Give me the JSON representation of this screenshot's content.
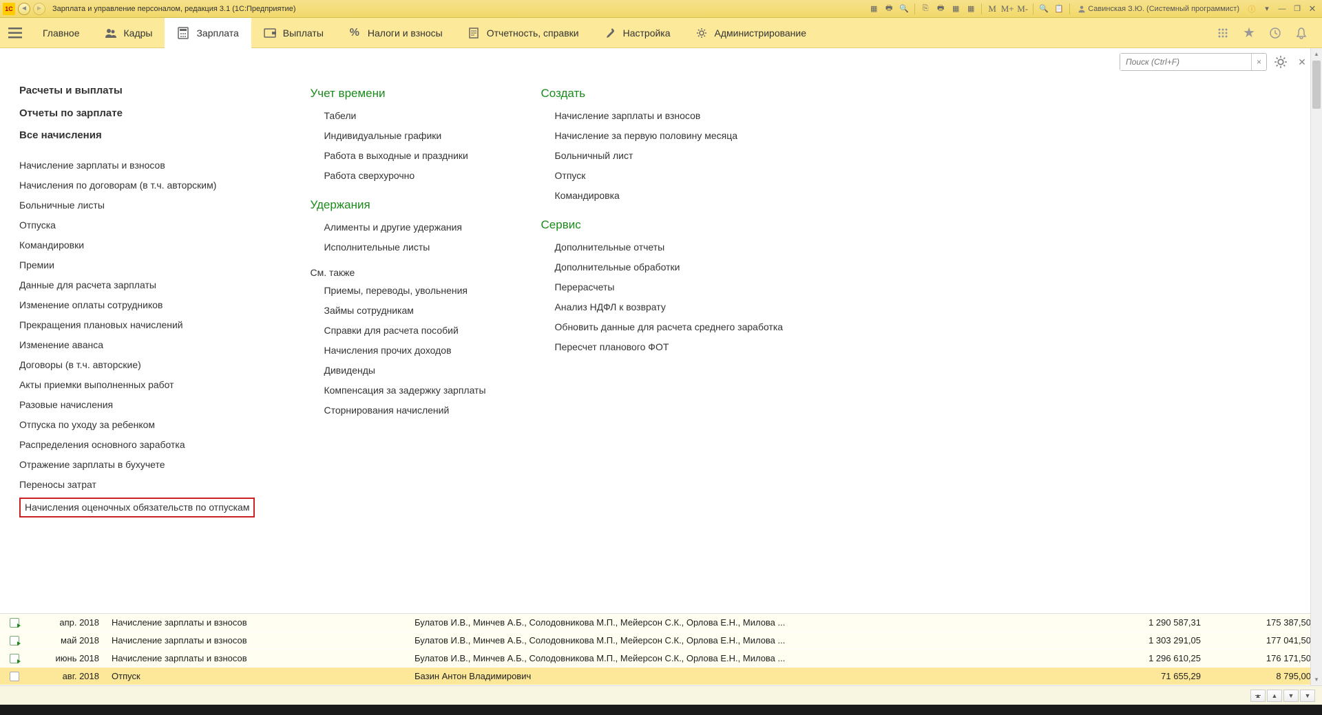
{
  "titlebar": {
    "title": "Зарплата и управление персоналом, редакция 3.1 (1С:Предприятие)",
    "memory": {
      "m": "M",
      "mplus": "M+",
      "mminus": "M-"
    },
    "user": "Савинская З.Ю. (Системный программист)"
  },
  "nav": {
    "main": "Главное",
    "hr": "Кадры",
    "salary": "Зарплата",
    "payments": "Выплаты",
    "taxes": "Налоги и взносы",
    "reports": "Отчетность, справки",
    "settings": "Настройка",
    "admin": "Администрирование"
  },
  "search": {
    "placeholder": "Поиск (Ctrl+F)"
  },
  "col1": {
    "h1": "Расчеты и выплаты",
    "h2": "Отчеты по зарплате",
    "h3": "Все начисления",
    "items": [
      "Начисление зарплаты и взносов",
      "Начисления по договорам (в т.ч. авторским)",
      "Больничные листы",
      "Отпуска",
      "Командировки",
      "Премии",
      "Данные для расчета зарплаты",
      "Изменение оплаты сотрудников",
      "Прекращения плановых начислений",
      "Изменение аванса",
      "Договоры (в т.ч. авторские)",
      "Акты приемки выполненных работ",
      "Разовые начисления",
      "Отпуска по уходу за ребенком",
      "Распределения основного заработка",
      "Отражение зарплаты в бухучете",
      "Переносы затрат"
    ],
    "highlighted": "Начисления оценочных обязательств по отпускам"
  },
  "col2": {
    "time_h": "Учет времени",
    "time": [
      "Табели",
      "Индивидуальные графики",
      "Работа в выходные и праздники",
      "Работа сверхурочно"
    ],
    "ded_h": "Удержания",
    "ded": [
      "Алименты и другие удержания",
      "Исполнительные листы"
    ],
    "see_also": "См. также",
    "see": [
      "Приемы, переводы, увольнения",
      "Займы сотрудникам",
      "Справки для расчета пособий",
      "Начисления прочих доходов",
      "Дивиденды",
      "Компенсация за задержку зарплаты",
      "Сторнирования начислений"
    ]
  },
  "col3": {
    "create_h": "Создать",
    "create": [
      "Начисление зарплаты и взносов",
      "Начисление за первую половину месяца",
      "Больничный лист",
      "Отпуск",
      "Командировка"
    ],
    "serv_h": "Сервис",
    "serv": [
      "Дополнительные отчеты",
      "Дополнительные обработки",
      "Перерасчеты",
      "Анализ НДФЛ к возврату",
      "Обновить данные для расчета среднего заработка",
      "Пересчет планового ФОТ"
    ]
  },
  "table": [
    {
      "period": "апр. 2018",
      "doc": "Начисление зарплаты и взносов",
      "emp": "Булатов И.В., Минчев А.Б., Солодовникова М.П., Мейерсон С.К., Орлова Е.Н., Милова ...",
      "s1": "1 290 587,31",
      "s2": "175 387,50",
      "posted": true
    },
    {
      "period": "май 2018",
      "doc": "Начисление зарплаты и взносов",
      "emp": "Булатов И.В., Минчев А.Б., Солодовникова М.П., Мейерсон С.К., Орлова Е.Н., Милова ...",
      "s1": "1 303 291,05",
      "s2": "177 041,50",
      "posted": true
    },
    {
      "period": "июнь 2018",
      "doc": "Начисление зарплаты и взносов",
      "emp": "Булатов И.В., Минчев А.Б., Солодовникова М.П., Мейерсон С.К., Орлова Е.Н., Милова ...",
      "s1": "1 296 610,25",
      "s2": "176 171,50",
      "posted": true
    },
    {
      "period": "авг. 2018",
      "doc": "Отпуск",
      "emp": "Базин Антон Владимирович",
      "s1": "71 655,29",
      "s2": "8 795,00",
      "posted": false,
      "selected": true
    }
  ]
}
